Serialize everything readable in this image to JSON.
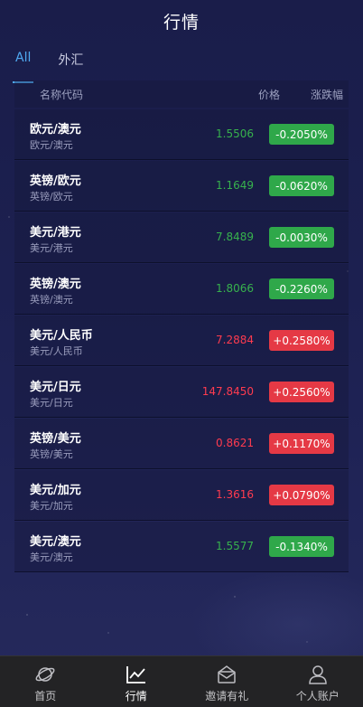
{
  "header": {
    "title": "行情"
  },
  "tabs": [
    {
      "label": "All",
      "active": true
    },
    {
      "label": "外汇",
      "active": false
    }
  ],
  "columns": {
    "name": "名称代码",
    "price": "价格",
    "change": "涨跌幅"
  },
  "rows": [
    {
      "name": "欧元/澳元",
      "code": "欧元/澳元",
      "price": "1.5506",
      "change": "-0.2050%",
      "direction": "down"
    },
    {
      "name": "英镑/欧元",
      "code": "英镑/欧元",
      "price": "1.1649",
      "change": "-0.0620%",
      "direction": "down"
    },
    {
      "name": "美元/港元",
      "code": "美元/港元",
      "price": "7.8489",
      "change": "-0.0030%",
      "direction": "down"
    },
    {
      "name": "英镑/澳元",
      "code": "英镑/澳元",
      "price": "1.8066",
      "change": "-0.2260%",
      "direction": "down"
    },
    {
      "name": "美元/人民币",
      "code": "美元/人民币",
      "price": "7.2884",
      "change": "+0.2580%",
      "direction": "up"
    },
    {
      "name": "美元/日元",
      "code": "美元/日元",
      "price": "147.8450",
      "change": "+0.2560%",
      "direction": "up"
    },
    {
      "name": "英镑/美元",
      "code": "英镑/美元",
      "price": "0.8621",
      "change": "+0.1170%",
      "direction": "up"
    },
    {
      "name": "美元/加元",
      "code": "美元/加元",
      "price": "1.3616",
      "change": "+0.0790%",
      "direction": "up"
    },
    {
      "name": "美元/澳元",
      "code": "美元/澳元",
      "price": "1.5577",
      "change": "-0.1340%",
      "direction": "down"
    }
  ],
  "tabbar": [
    {
      "label": "首页",
      "icon": "planet-icon",
      "active": false
    },
    {
      "label": "行情",
      "icon": "chart-line-icon",
      "active": true
    },
    {
      "label": "邀请有礼",
      "icon": "envelope-icon",
      "active": false
    },
    {
      "label": "个人账户",
      "icon": "user-icon",
      "active": false
    }
  ],
  "colors": {
    "up": "#e53945",
    "down": "#2fa84a",
    "accent": "#4fa8f0"
  }
}
